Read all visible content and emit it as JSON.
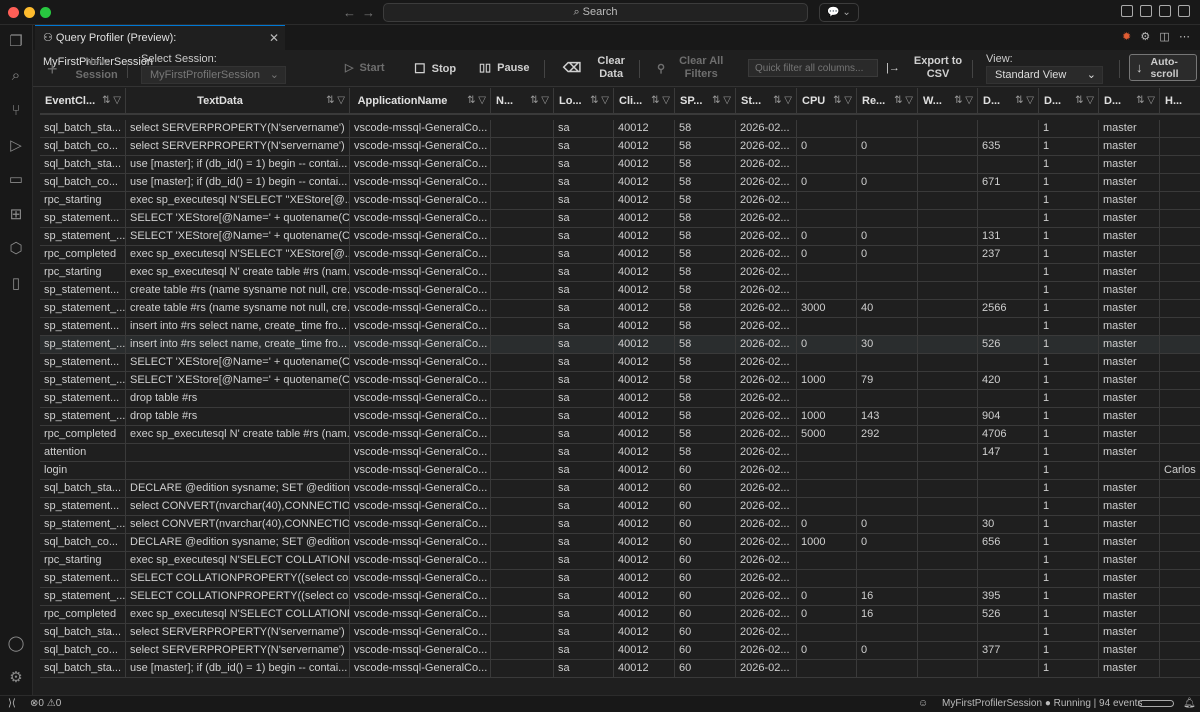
{
  "window": {
    "search_placeholder": "Search",
    "colors": {
      "close": "#ff5f57",
      "minimize": "#febc2e",
      "maximize": "#28c840",
      "accent": "#0078d4"
    }
  },
  "tab": {
    "title": "Query Profiler (Preview): MyFirstProfilerSession",
    "icon": "hierarchy-icon"
  },
  "toolbar": {
    "new_session": "New\nSession",
    "select_session_label": "Select Session:",
    "select_session_value": "MyFirstProfilerSession",
    "start": "Start",
    "stop": "Stop",
    "pause": "Pause",
    "clear_data": "Clear\nData",
    "clear_filters": "Clear All\nFilters",
    "quick_filter_placeholder": "Quick filter all columns...",
    "export": "Export to\nCSV",
    "view_label": "View:",
    "view_value": "Standard View",
    "autoscroll": "Auto-\nscroll"
  },
  "grid": {
    "columns": [
      "EventCl...",
      "TextData",
      "ApplicationName",
      "N...",
      "Lo...",
      "Cli...",
      "SP...",
      "St...",
      "CPU",
      "Re...",
      "W...",
      "D...",
      "D...",
      "D...",
      "H..."
    ],
    "selected_row": 12,
    "rows": [
      [
        "sql_batch_sta...",
        "select SERVERPROPERTY(N'servername')",
        "vscode-mssql-GeneralCo...",
        "",
        "sa",
        "40012",
        "58",
        "2026-02...",
        "",
        "",
        "",
        "",
        "1",
        "master",
        ""
      ],
      [
        "sql_batch_co...",
        "select SERVERPROPERTY(N'servername')",
        "vscode-mssql-GeneralCo...",
        "",
        "sa",
        "40012",
        "58",
        "2026-02...",
        "0",
        "0",
        "",
        "635",
        "1",
        "master",
        ""
      ],
      [
        "sql_batch_sta...",
        "use [master]; if (db_id() = 1) begin -- contai...",
        "vscode-mssql-GeneralCo...",
        "",
        "sa",
        "40012",
        "58",
        "2026-02...",
        "",
        "",
        "",
        "",
        "1",
        "master",
        ""
      ],
      [
        "sql_batch_co...",
        "use [master]; if (db_id() = 1) begin -- contai...",
        "vscode-mssql-GeneralCo...",
        "",
        "sa",
        "40012",
        "58",
        "2026-02...",
        "0",
        "0",
        "",
        "671",
        "1",
        "master",
        ""
      ],
      [
        "rpc_starting",
        "exec sp_executesql N'SELECT ''XEStore[@...",
        "vscode-mssql-GeneralCo...",
        "",
        "sa",
        "40012",
        "58",
        "2026-02...",
        "",
        "",
        "",
        "",
        "1",
        "master",
        ""
      ],
      [
        "sp_statement...",
        "SELECT 'XEStore[@Name=' + quotename(C...",
        "vscode-mssql-GeneralCo...",
        "",
        "sa",
        "40012",
        "58",
        "2026-02...",
        "",
        "",
        "",
        "",
        "1",
        "master",
        ""
      ],
      [
        "sp_statement_...",
        "SELECT 'XEStore[@Name=' + quotename(C...",
        "vscode-mssql-GeneralCo...",
        "",
        "sa",
        "40012",
        "58",
        "2026-02...",
        "0",
        "0",
        "",
        "131",
        "1",
        "master",
        ""
      ],
      [
        "rpc_completed",
        "exec sp_executesql N'SELECT ''XEStore[@...",
        "vscode-mssql-GeneralCo...",
        "",
        "sa",
        "40012",
        "58",
        "2026-02...",
        "0",
        "0",
        "",
        "237",
        "1",
        "master",
        ""
      ],
      [
        "rpc_starting",
        "exec sp_executesql N' create table #rs (nam...",
        "vscode-mssql-GeneralCo...",
        "",
        "sa",
        "40012",
        "58",
        "2026-02...",
        "",
        "",
        "",
        "",
        "1",
        "master",
        ""
      ],
      [
        "sp_statement...",
        "create table #rs (name sysname not null, cre...",
        "vscode-mssql-GeneralCo...",
        "",
        "sa",
        "40012",
        "58",
        "2026-02...",
        "",
        "",
        "",
        "",
        "1",
        "master",
        ""
      ],
      [
        "sp_statement_...",
        "create table #rs (name sysname not null, cre...",
        "vscode-mssql-GeneralCo...",
        "",
        "sa",
        "40012",
        "58",
        "2026-02...",
        "3000",
        "40",
        "",
        "2566",
        "1",
        "master",
        ""
      ],
      [
        "sp_statement...",
        "insert into #rs select name, create_time fro...",
        "vscode-mssql-GeneralCo...",
        "",
        "sa",
        "40012",
        "58",
        "2026-02...",
        "",
        "",
        "",
        "",
        "1",
        "master",
        ""
      ],
      [
        "sp_statement_...",
        "insert into #rs select name, create_time fro...",
        "vscode-mssql-GeneralCo...",
        "",
        "sa",
        "40012",
        "58",
        "2026-02...",
        "0",
        "30",
        "",
        "526",
        "1",
        "master",
        ""
      ],
      [
        "sp_statement...",
        "SELECT 'XEStore[@Name=' + quotename(C...",
        "vscode-mssql-GeneralCo...",
        "",
        "sa",
        "40012",
        "58",
        "2026-02...",
        "",
        "",
        "",
        "",
        "1",
        "master",
        ""
      ],
      [
        "sp_statement_...",
        "SELECT 'XEStore[@Name=' + quotename(C...",
        "vscode-mssql-GeneralCo...",
        "",
        "sa",
        "40012",
        "58",
        "2026-02...",
        "1000",
        "79",
        "",
        "420",
        "1",
        "master",
        ""
      ],
      [
        "sp_statement...",
        "drop table #rs",
        "vscode-mssql-GeneralCo...",
        "",
        "sa",
        "40012",
        "58",
        "2026-02...",
        "",
        "",
        "",
        "",
        "1",
        "master",
        ""
      ],
      [
        "sp_statement_...",
        "drop table #rs",
        "vscode-mssql-GeneralCo...",
        "",
        "sa",
        "40012",
        "58",
        "2026-02...",
        "1000",
        "143",
        "",
        "904",
        "1",
        "master",
        ""
      ],
      [
        "rpc_completed",
        "exec sp_executesql N' create table #rs (nam...",
        "vscode-mssql-GeneralCo...",
        "",
        "sa",
        "40012",
        "58",
        "2026-02...",
        "5000",
        "292",
        "",
        "4706",
        "1",
        "master",
        ""
      ],
      [
        "attention",
        "",
        "vscode-mssql-GeneralCo...",
        "",
        "sa",
        "40012",
        "58",
        "2026-02...",
        "",
        "",
        "",
        "147",
        "1",
        "master",
        ""
      ],
      [
        "login",
        "",
        "vscode-mssql-GeneralCo...",
        "",
        "sa",
        "40012",
        "60",
        "2026-02...",
        "",
        "",
        "",
        "",
        "1",
        "",
        "Carlos"
      ],
      [
        "sql_batch_sta...",
        "DECLARE @edition sysname; SET @edition ...",
        "vscode-mssql-GeneralCo...",
        "",
        "sa",
        "40012",
        "60",
        "2026-02...",
        "",
        "",
        "",
        "",
        "1",
        "master",
        ""
      ],
      [
        "sp_statement...",
        "select CONVERT(nvarchar(40),CONNECTIO...",
        "vscode-mssql-GeneralCo...",
        "",
        "sa",
        "40012",
        "60",
        "2026-02...",
        "",
        "",
        "",
        "",
        "1",
        "master",
        ""
      ],
      [
        "sp_statement_...",
        "select CONVERT(nvarchar(40),CONNECTIO...",
        "vscode-mssql-GeneralCo...",
        "",
        "sa",
        "40012",
        "60",
        "2026-02...",
        "0",
        "0",
        "",
        "30",
        "1",
        "master",
        ""
      ],
      [
        "sql_batch_co...",
        "DECLARE @edition sysname; SET @edition ...",
        "vscode-mssql-GeneralCo...",
        "",
        "sa",
        "40012",
        "60",
        "2026-02...",
        "1000",
        "0",
        "",
        "656",
        "1",
        "master",
        ""
      ],
      [
        "rpc_starting",
        "exec sp_executesql N'SELECT COLLATIONP...",
        "vscode-mssql-GeneralCo...",
        "",
        "sa",
        "40012",
        "60",
        "2026-02...",
        "",
        "",
        "",
        "",
        "1",
        "master",
        ""
      ],
      [
        "sp_statement...",
        "SELECT COLLATIONPROPERTY((select coll...",
        "vscode-mssql-GeneralCo...",
        "",
        "sa",
        "40012",
        "60",
        "2026-02...",
        "",
        "",
        "",
        "",
        "1",
        "master",
        ""
      ],
      [
        "sp_statement_...",
        "SELECT COLLATIONPROPERTY((select coll...",
        "vscode-mssql-GeneralCo...",
        "",
        "sa",
        "40012",
        "60",
        "2026-02...",
        "0",
        "16",
        "",
        "395",
        "1",
        "master",
        ""
      ],
      [
        "rpc_completed",
        "exec sp_executesql N'SELECT COLLATIONP...",
        "vscode-mssql-GeneralCo...",
        "",
        "sa",
        "40012",
        "60",
        "2026-02...",
        "0",
        "16",
        "",
        "526",
        "1",
        "master",
        ""
      ],
      [
        "sql_batch_sta...",
        "select SERVERPROPERTY(N'servername')",
        "vscode-mssql-GeneralCo...",
        "",
        "sa",
        "40012",
        "60",
        "2026-02...",
        "",
        "",
        "",
        "",
        "1",
        "master",
        ""
      ],
      [
        "sql_batch_co...",
        "select SERVERPROPERTY(N'servername')",
        "vscode-mssql-GeneralCo...",
        "",
        "sa",
        "40012",
        "60",
        "2026-02...",
        "0",
        "0",
        "",
        "377",
        "1",
        "master",
        ""
      ],
      [
        "sql_batch_sta...",
        "use [master]; if (db_id() = 1) begin -- contai...",
        "vscode-mssql-GeneralCo...",
        "",
        "sa",
        "40012",
        "60",
        "2026-02...",
        "",
        "",
        "",
        "",
        "1",
        "master",
        ""
      ]
    ]
  },
  "status": {
    "errors": "0",
    "warnings": "0",
    "session": "MyFirstProfilerSession",
    "state": "Running | 94 events"
  }
}
